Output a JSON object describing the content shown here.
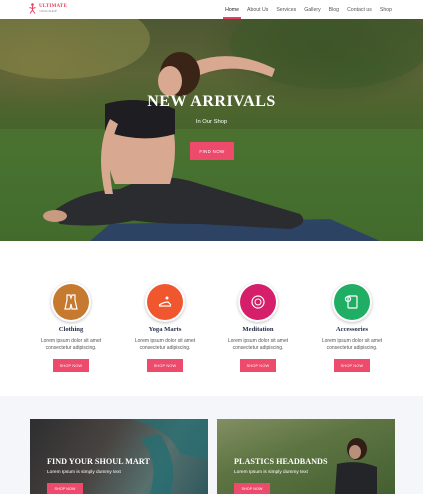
{
  "header": {
    "logo_name": "ULTIMATE",
    "logo_sub": "YOGA SHOP"
  },
  "nav": [
    {
      "label": "Home"
    },
    {
      "label": "About Us"
    },
    {
      "label": "Services"
    },
    {
      "label": "Gallery"
    },
    {
      "label": "Blog"
    },
    {
      "label": "Contact us"
    },
    {
      "label": "Shop"
    }
  ],
  "hero": {
    "title": "NEW ARRIVALS",
    "subtitle": "In Our Shop",
    "button": "FIND NOW"
  },
  "features": [
    {
      "icon": "clothing-icon",
      "color": "#c67a2f",
      "title": "Clothing",
      "text_line1": "Lorem ipsum dolor sit amet",
      "text_line2": "consectetur adipiscing.",
      "button": "SHOP NOW"
    },
    {
      "icon": "yoga-mat-icon",
      "color": "#f0572f",
      "title": "Yoga Marts",
      "text_line1": "Lorem ipsum dolor sit amet",
      "text_line2": "consectetur adipiscing.",
      "button": "SHOP NOW"
    },
    {
      "icon": "meditation-icon",
      "color": "#d61f6a",
      "title": "Meditation",
      "text_line1": "Lorem ipsum dolor sit amet",
      "text_line2": "consectetur adipiscing.",
      "button": "SHOP NOW"
    },
    {
      "icon": "accessories-icon",
      "color": "#1fae63",
      "title": "Accessories",
      "text_line1": "Lorem ipsum dolor sit amet",
      "text_line2": "consectetur adipiscing.",
      "button": "SHOP NOW"
    }
  ],
  "promos": [
    {
      "title": "FIND YOUR SHOUL MART",
      "text": "Lorem Ipsum is simply dummy text",
      "button": "SHOP NOW"
    },
    {
      "title": "PLASTICS HEADBANDS",
      "text": "Lorem Ipsum is simply dummy text",
      "button": "SHOP NOW"
    }
  ],
  "colors": {
    "accent": "#ee4a6c",
    "heading": "#1f2a44"
  }
}
